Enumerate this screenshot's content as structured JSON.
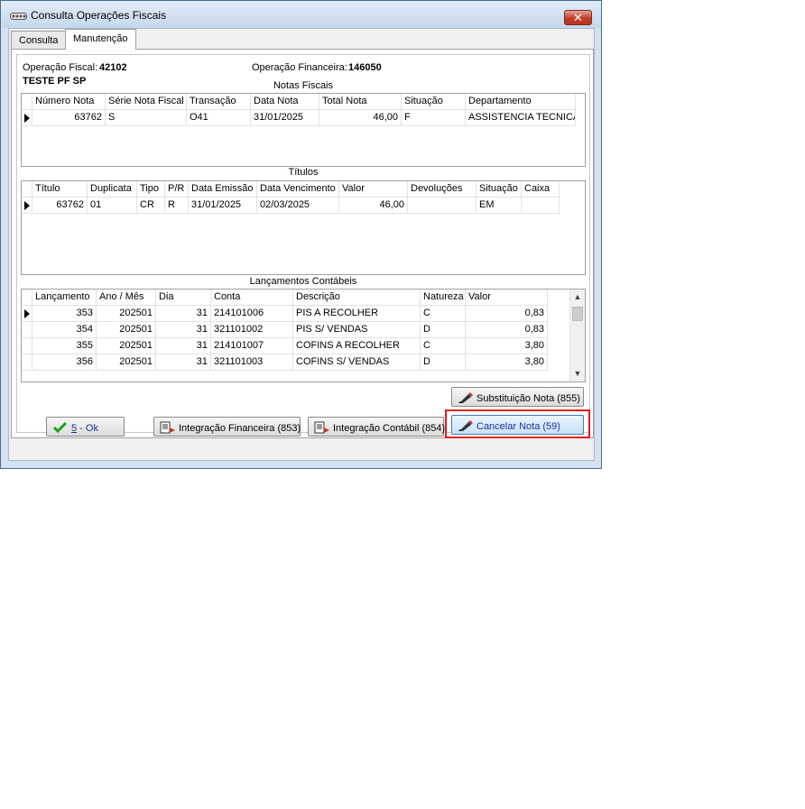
{
  "window": {
    "title": "Consulta Operações Fiscais",
    "close_label": "✕"
  },
  "tabs": [
    {
      "label": "Consulta"
    },
    {
      "label": "Manutenção"
    }
  ],
  "header": {
    "op_fiscal_label": "Operação Fiscal:",
    "op_fiscal_value": "42102",
    "op_financeira_label": "Operação Financeira:",
    "op_financeira_value": "146050",
    "client_name": "TESTE PF SP"
  },
  "notas": {
    "title": "Notas Fiscais",
    "columns": [
      "Número Nota",
      "Série Nota Fiscal",
      "Transação",
      "Data Nota",
      "Total Nota",
      "Situação",
      "Departamento"
    ],
    "rows": [
      [
        "63762",
        "S",
        "O41",
        "31/01/2025",
        "46,00",
        "F",
        "ASSISTENCIA TECNICA"
      ]
    ]
  },
  "titulos": {
    "title": "Títulos",
    "columns": [
      "Título",
      "Duplicata",
      "Tipo",
      "P/R",
      "Data Emissão",
      "Data Vencimento",
      "Valor",
      "Devoluções",
      "Situação",
      "Caixa"
    ],
    "rows": [
      [
        "63762",
        "01",
        "CR",
        "R",
        "31/01/2025",
        "02/03/2025",
        "46,00",
        "",
        "EM",
        ""
      ]
    ]
  },
  "lancamentos": {
    "title": "Lançamentos Contábeis",
    "columns": [
      "Lançamento",
      "Ano / Mês",
      "Dia",
      "Conta",
      "Descrição",
      "Natureza",
      "Valor"
    ],
    "rows": [
      [
        "353",
        "202501",
        "31",
        "214101006",
        "PIS A RECOLHER",
        "C",
        "0,83"
      ],
      [
        "354",
        "202501",
        "31",
        "321101002",
        "PIS S/ VENDAS",
        "D",
        "0,83"
      ],
      [
        "355",
        "202501",
        "31",
        "214101007",
        "COFINS A RECOLHER",
        "C",
        "3,80"
      ],
      [
        "356",
        "202501",
        "31",
        "321101003",
        "COFINS S/ VENDAS",
        "D",
        "3,80"
      ]
    ]
  },
  "buttons": {
    "substituicao": "Substituição Nota (855)",
    "ok_hotkey": "5",
    "ok_rest": " - Ok",
    "integracao_financeira": "Integração Financeira (853)",
    "integracao_contabil": "Integração Contábil (854)",
    "cancelar": "Cancelar Nota (59)"
  },
  "colors": {
    "highlight": "#e21b1b",
    "cancel_text": "#1f2f9a",
    "ok_check": "#1aa31a"
  }
}
